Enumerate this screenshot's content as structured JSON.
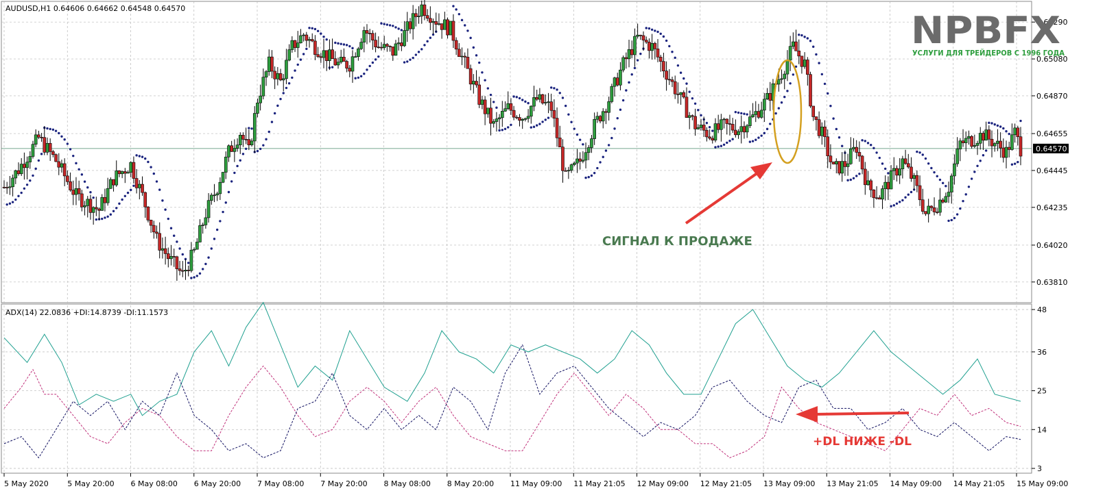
{
  "chart_data": [
    {
      "type": "candlestick",
      "title": "AUDUSD,H1  0.64606 0.64662 0.64548 0.64570",
      "symbol": "AUDUSD,H1",
      "ohlc_header": "0.64606 0.64662 0.64548 0.64570",
      "last_price_label": "0.64570",
      "last_price": 0.6457,
      "ylim": [
        0.637,
        0.654
      ],
      "y_ticks": [
        "0.65290",
        "0.65080",
        "0.64870",
        "0.64655",
        "0.64445",
        "0.64235",
        "0.64020",
        "0.63810"
      ],
      "y_tick_values": [
        0.6529,
        0.6508,
        0.6487,
        0.64655,
        0.64445,
        0.64235,
        0.6402,
        0.6381
      ],
      "x_ticks": [
        "5 May 2020",
        "5 May 20:00",
        "6 May 08:00",
        "6 May 20:00",
        "7 May 08:00",
        "7 May 20:00",
        "8 May 08:00",
        "8 May 20:00",
        "11 May 09:00",
        "11 May 21:05",
        "12 May 09:00",
        "12 May 21:05",
        "13 May 09:00",
        "13 May 21:05",
        "14 May 09:00",
        "14 May 21:05",
        "15 May 09:00"
      ],
      "grid": true,
      "indicators": [
        "Parabolic SAR"
      ],
      "annotation": "СИГНАЛ К ПРОДАЖЕ",
      "close_path": [
        [
          0,
          0.6435
        ],
        [
          5,
          0.6445
        ],
        [
          12,
          0.6463
        ],
        [
          18,
          0.645
        ],
        [
          25,
          0.643
        ],
        [
          33,
          0.6422
        ],
        [
          38,
          0.644
        ],
        [
          44,
          0.6448
        ],
        [
          48,
          0.643
        ],
        [
          53,
          0.6405
        ],
        [
          57,
          0.6395
        ],
        [
          62,
          0.6385
        ],
        [
          66,
          0.6398
        ],
        [
          70,
          0.642
        ],
        [
          74,
          0.6435
        ],
        [
          78,
          0.6455
        ],
        [
          82,
          0.6466
        ],
        [
          85,
          0.6455
        ],
        [
          88,
          0.6485
        ],
        [
          92,
          0.6505
        ],
        [
          96,
          0.6495
        ],
        [
          100,
          0.6515
        ],
        [
          104,
          0.6522
        ],
        [
          108,
          0.6515
        ],
        [
          112,
          0.651
        ],
        [
          116,
          0.6505
        ],
        [
          120,
          0.6505
        ],
        [
          125,
          0.6525
        ],
        [
          130,
          0.6515
        ],
        [
          135,
          0.6512
        ],
        [
          140,
          0.6525
        ],
        [
          145,
          0.6538
        ],
        [
          150,
          0.653
        ],
        [
          155,
          0.6525
        ],
        [
          160,
          0.6505
        ],
        [
          165,
          0.6485
        ],
        [
          170,
          0.647
        ],
        [
          175,
          0.648
        ],
        [
          180,
          0.6475
        ],
        [
          185,
          0.6485
        ],
        [
          190,
          0.648
        ],
        [
          195,
          0.644
        ],
        [
          200,
          0.645
        ],
        [
          205,
          0.647
        ],
        [
          210,
          0.6485
        ],
        [
          215,
          0.6505
        ],
        [
          220,
          0.652
        ],
        [
          225,
          0.6515
        ],
        [
          230,
          0.65
        ],
        [
          235,
          0.6485
        ],
        [
          240,
          0.647
        ],
        [
          245,
          0.6465
        ],
        [
          250,
          0.647
        ],
        [
          255,
          0.6468
        ],
        [
          260,
          0.6475
        ],
        [
          265,
          0.6485
        ],
        [
          270,
          0.65
        ],
        [
          274,
          0.6515
        ],
        [
          278,
          0.6505
        ],
        [
          281,
          0.6475
        ],
        [
          284,
          0.6465
        ],
        [
          288,
          0.6445
        ],
        [
          292,
          0.6448
        ],
        [
          296,
          0.6458
        ],
        [
          300,
          0.6435
        ],
        [
          304,
          0.643
        ],
        [
          308,
          0.644
        ],
        [
          312,
          0.645
        ],
        [
          316,
          0.6438
        ],
        [
          320,
          0.642
        ],
        [
          324,
          0.6425
        ],
        [
          328,
          0.6435
        ],
        [
          332,
          0.646
        ],
        [
          336,
          0.6462
        ],
        [
          340,
          0.6465
        ],
        [
          344,
          0.646
        ],
        [
          348,
          0.6455
        ],
        [
          351,
          0.6466
        ],
        [
          353,
          0.6457
        ]
      ]
    },
    {
      "type": "line",
      "title": "ADX(14) 22.0836 +DI:14.8739 -DI:11.1573",
      "ylim": [
        3,
        48
      ],
      "y_ticks": [
        "48",
        "36",
        "25",
        "14",
        "3"
      ],
      "series": [
        {
          "name": "ADX(14) 22.0836",
          "color": "#20a090",
          "values": [
            [
              0,
              40
            ],
            [
              8,
              33
            ],
            [
              14,
              41
            ],
            [
              20,
              33
            ],
            [
              26,
              21
            ],
            [
              32,
              24
            ],
            [
              38,
              22
            ],
            [
              44,
              24
            ],
            [
              48,
              18
            ],
            [
              54,
              22
            ],
            [
              60,
              24
            ],
            [
              66,
              36
            ],
            [
              72,
              42
            ],
            [
              78,
              32
            ],
            [
              84,
              43
            ],
            [
              90,
              50
            ],
            [
              96,
              38
            ],
            [
              102,
              26
            ],
            [
              108,
              32
            ],
            [
              114,
              28
            ],
            [
              120,
              42
            ],
            [
              126,
              34
            ],
            [
              132,
              26
            ],
            [
              136,
              24
            ],
            [
              140,
              22
            ],
            [
              146,
              30
            ],
            [
              152,
              42
            ],
            [
              158,
              36
            ],
            [
              164,
              34
            ],
            [
              170,
              30
            ],
            [
              176,
              38
            ],
            [
              182,
              36
            ],
            [
              188,
              38
            ],
            [
              194,
              36
            ],
            [
              200,
              34
            ],
            [
              206,
              30
            ],
            [
              212,
              34
            ],
            [
              218,
              42
            ],
            [
              224,
              38
            ],
            [
              230,
              30
            ],
            [
              236,
              24
            ],
            [
              242,
              24
            ],
            [
              248,
              34
            ],
            [
              254,
              44
            ],
            [
              260,
              48
            ],
            [
              266,
              40
            ],
            [
              272,
              32
            ],
            [
              278,
              28
            ],
            [
              284,
              26
            ],
            [
              290,
              30
            ],
            [
              296,
              36
            ],
            [
              302,
              42
            ],
            [
              308,
              36
            ],
            [
              314,
              32
            ],
            [
              320,
              28
            ],
            [
              326,
              24
            ],
            [
              332,
              28
            ],
            [
              338,
              34
            ],
            [
              344,
              24
            ],
            [
              353,
              22
            ]
          ]
        },
        {
          "name": "+DI:14.8739",
          "color": "#c0307a",
          "values": [
            [
              0,
              20
            ],
            [
              6,
              26
            ],
            [
              10,
              31
            ],
            [
              14,
              24
            ],
            [
              18,
              24
            ],
            [
              24,
              18
            ],
            [
              30,
              12
            ],
            [
              36,
              10
            ],
            [
              42,
              16
            ],
            [
              48,
              20
            ],
            [
              54,
              18
            ],
            [
              60,
              12
            ],
            [
              66,
              8
            ],
            [
              72,
              8
            ],
            [
              78,
              18
            ],
            [
              84,
              26
            ],
            [
              90,
              32
            ],
            [
              96,
              26
            ],
            [
              102,
              18
            ],
            [
              108,
              12
            ],
            [
              114,
              14
            ],
            [
              120,
              22
            ],
            [
              126,
              26
            ],
            [
              132,
              22
            ],
            [
              138,
              16
            ],
            [
              144,
              22
            ],
            [
              150,
              26
            ],
            [
              156,
              18
            ],
            [
              162,
              12
            ],
            [
              168,
              10
            ],
            [
              174,
              8
            ],
            [
              180,
              8
            ],
            [
              186,
              16
            ],
            [
              192,
              24
            ],
            [
              198,
              30
            ],
            [
              204,
              24
            ],
            [
              210,
              18
            ],
            [
              216,
              24
            ],
            [
              222,
              20
            ],
            [
              228,
              14
            ],
            [
              234,
              14
            ],
            [
              240,
              10
            ],
            [
              246,
              10
            ],
            [
              252,
              6
            ],
            [
              258,
              8
            ],
            [
              264,
              12
            ],
            [
              270,
              26
            ],
            [
              276,
              20
            ],
            [
              282,
              16
            ],
            [
              288,
              14
            ],
            [
              294,
              12
            ],
            [
              300,
              10
            ],
            [
              306,
              8
            ],
            [
              312,
              14
            ],
            [
              318,
              20
            ],
            [
              324,
              18
            ],
            [
              330,
              24
            ],
            [
              336,
              18
            ],
            [
              342,
              20
            ],
            [
              348,
              16
            ],
            [
              353,
              14.9
            ]
          ]
        },
        {
          "name": "-DI:11.1573",
          "color": "#101060",
          "values": [
            [
              0,
              10
            ],
            [
              6,
              12
            ],
            [
              12,
              6
            ],
            [
              18,
              14
            ],
            [
              24,
              22
            ],
            [
              30,
              18
            ],
            [
              36,
              22
            ],
            [
              42,
              14
            ],
            [
              48,
              22
            ],
            [
              54,
              18
            ],
            [
              60,
              30
            ],
            [
              66,
              18
            ],
            [
              72,
              14
            ],
            [
              78,
              8
            ],
            [
              84,
              10
            ],
            [
              90,
              6
            ],
            [
              96,
              8
            ],
            [
              102,
              20
            ],
            [
              108,
              22
            ],
            [
              114,
              30
            ],
            [
              120,
              18
            ],
            [
              126,
              14
            ],
            [
              132,
              20
            ],
            [
              138,
              14
            ],
            [
              144,
              18
            ],
            [
              150,
              14
            ],
            [
              156,
              26
            ],
            [
              162,
              22
            ],
            [
              168,
              14
            ],
            [
              174,
              30
            ],
            [
              180,
              38
            ],
            [
              186,
              24
            ],
            [
              192,
              30
            ],
            [
              198,
              32
            ],
            [
              204,
              26
            ],
            [
              210,
              20
            ],
            [
              216,
              16
            ],
            [
              222,
              12
            ],
            [
              228,
              16
            ],
            [
              234,
              14
            ],
            [
              240,
              18
            ],
            [
              246,
              26
            ],
            [
              252,
              28
            ],
            [
              258,
              22
            ],
            [
              264,
              18
            ],
            [
              270,
              16
            ],
            [
              276,
              26
            ],
            [
              282,
              28
            ],
            [
              288,
              20
            ],
            [
              294,
              20
            ],
            [
              300,
              14
            ],
            [
              306,
              16
            ],
            [
              312,
              20
            ],
            [
              318,
              14
            ],
            [
              324,
              12
            ],
            [
              330,
              16
            ],
            [
              336,
              12
            ],
            [
              342,
              8
            ],
            [
              348,
              12
            ],
            [
              353,
              11.2
            ]
          ]
        }
      ],
      "x_ticks": [
        "5 May 2020",
        "5 May 20:00",
        "6 May 08:00",
        "6 May 20:00",
        "7 May 08:00",
        "7 May 20:00",
        "8 May 08:00",
        "8 May 20:00",
        "11 May 09:00",
        "11 May 21:05",
        "12 May 09:00",
        "12 May 21:05",
        "13 May 09:00",
        "13 May 21:05",
        "14 May 09:00",
        "14 May 21:05",
        "15 May 09:00"
      ],
      "annotation": "+DL НИЖЕ -DL"
    }
  ],
  "logo": {
    "brand": "NPBFX",
    "tagline": "УСЛУГИ ДЛЯ ТРЕЙДЕРОВ С 1996 ГОДА"
  },
  "colors": {
    "bull": "#2e9e3e",
    "bear": "#c62828",
    "sar": "#1a237e",
    "arrow": "#e53935",
    "signal_text": "#4a7a50",
    "highlight": "#d4a020",
    "logo_gray": "#6b6b6b",
    "logo_green": "#2e9e3e"
  }
}
